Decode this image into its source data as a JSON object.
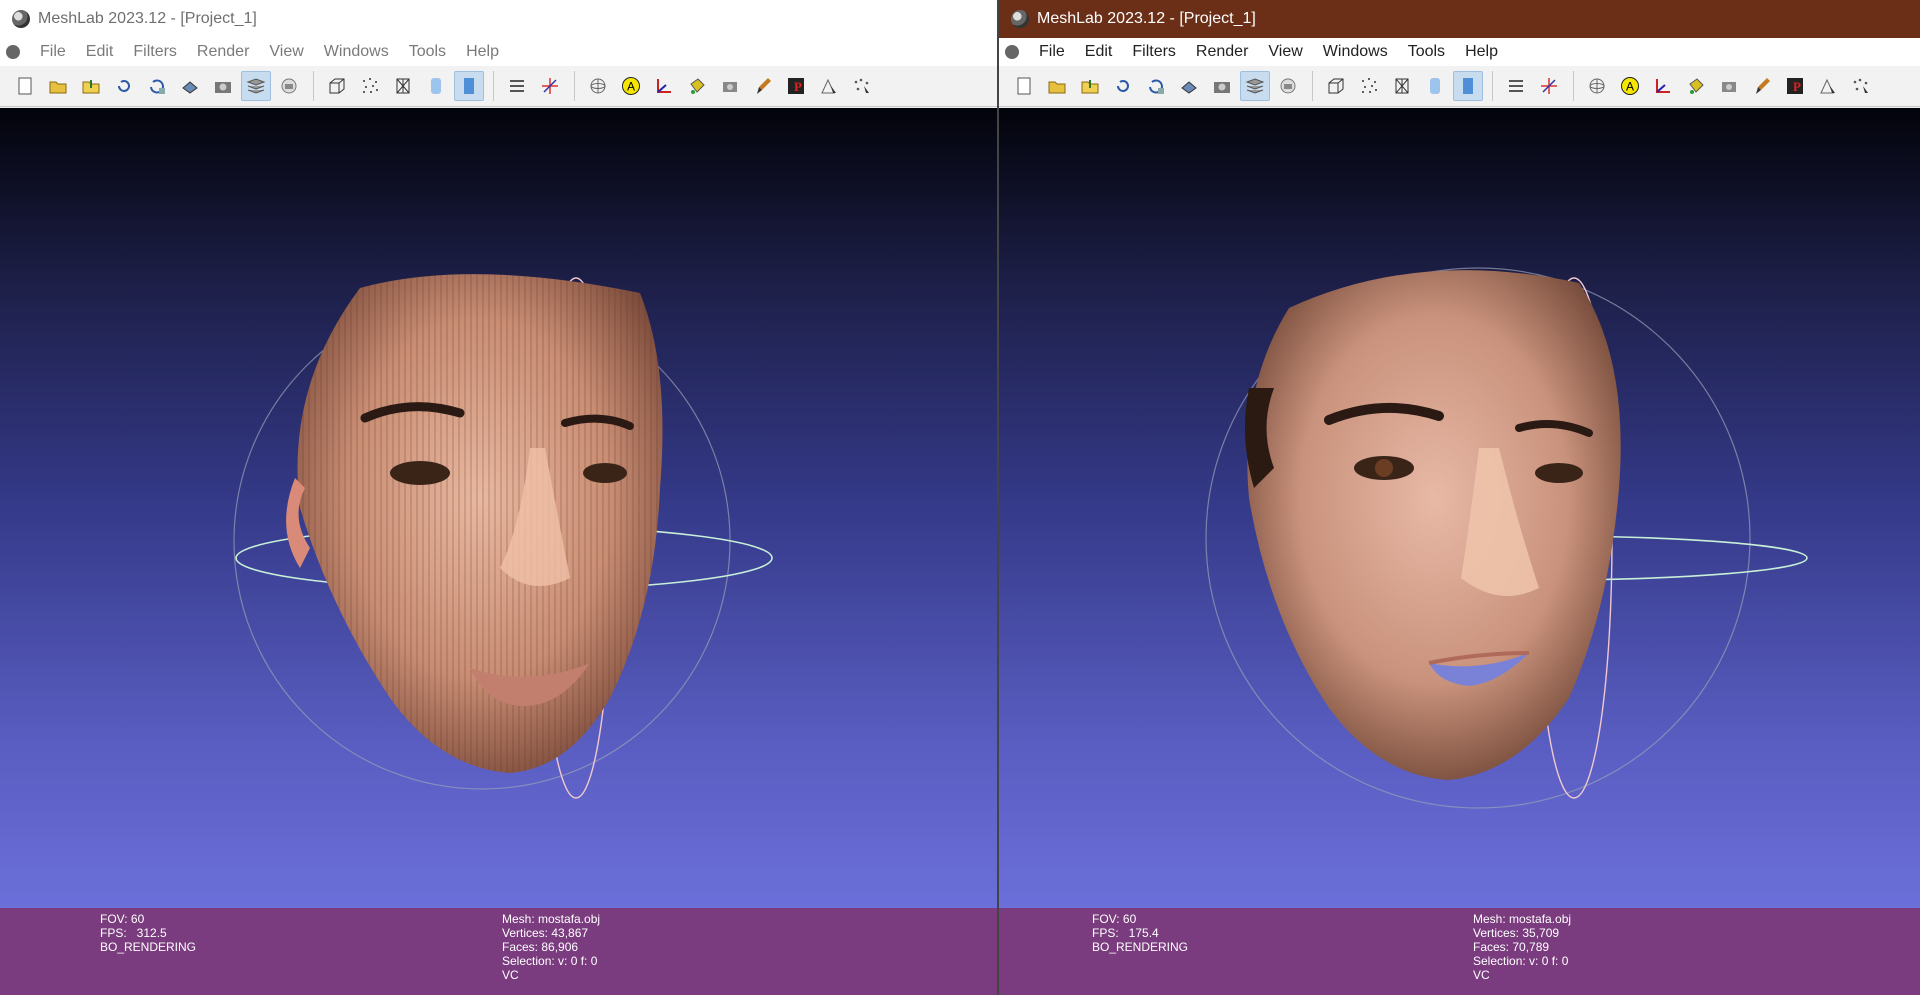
{
  "windows": [
    {
      "title": "MeshLab 2023.12 - [Project_1]",
      "menu": [
        "File",
        "Edit",
        "Filters",
        "Render",
        "View",
        "Windows",
        "Tools",
        "Help"
      ],
      "status": {
        "left": [
          "FOV: 60",
          "FPS:   312.5",
          "BO_RENDERING"
        ],
        "right": [
          "Mesh: mostafa.obj",
          "Vertices: 43,867",
          "Faces: 86,906",
          "Selection: v: 0 f: 0",
          "VC"
        ]
      }
    },
    {
      "title": "MeshLab 2023.12 - [Project_1]",
      "menu": [
        "File",
        "Edit",
        "Filters",
        "Render",
        "View",
        "Windows",
        "Tools",
        "Help"
      ],
      "status": {
        "left": [
          "FOV: 60",
          "FPS:   175.4",
          "BO_RENDERING"
        ],
        "right": [
          "Mesh: mostafa.obj",
          "Vertices: 35,709",
          "Faces: 70,789",
          "Selection: v: 0 f: 0",
          "VC"
        ]
      }
    }
  ],
  "toolbar_icons": [
    "new-project-icon",
    "open-project-icon",
    "import-mesh-icon",
    "reload-icon",
    "reload-all-icon",
    "export-mesh-icon",
    "snapshot-icon",
    "layers-icon",
    "raster-icon",
    "bounding-box-icon",
    "points-icon",
    "wireframe-icon",
    "flat-shading-icon",
    "smooth-shading-icon",
    "light-icon",
    "axis-tool-icon",
    "trackball-icon",
    "annotation-a-icon",
    "measure-tool-icon",
    "paint-bucket-icon",
    "camera-tool-icon",
    "paint-brush-icon",
    "pick-points-icon",
    "select-faces-icon",
    "select-vertices-icon"
  ],
  "colors": {
    "left_titlebar": "#ffffff",
    "right_titlebar": "#6b2f18",
    "status_bar": "#7a3c7f",
    "viewport_top": "#02030a",
    "viewport_bottom": "#6b6fd9"
  }
}
